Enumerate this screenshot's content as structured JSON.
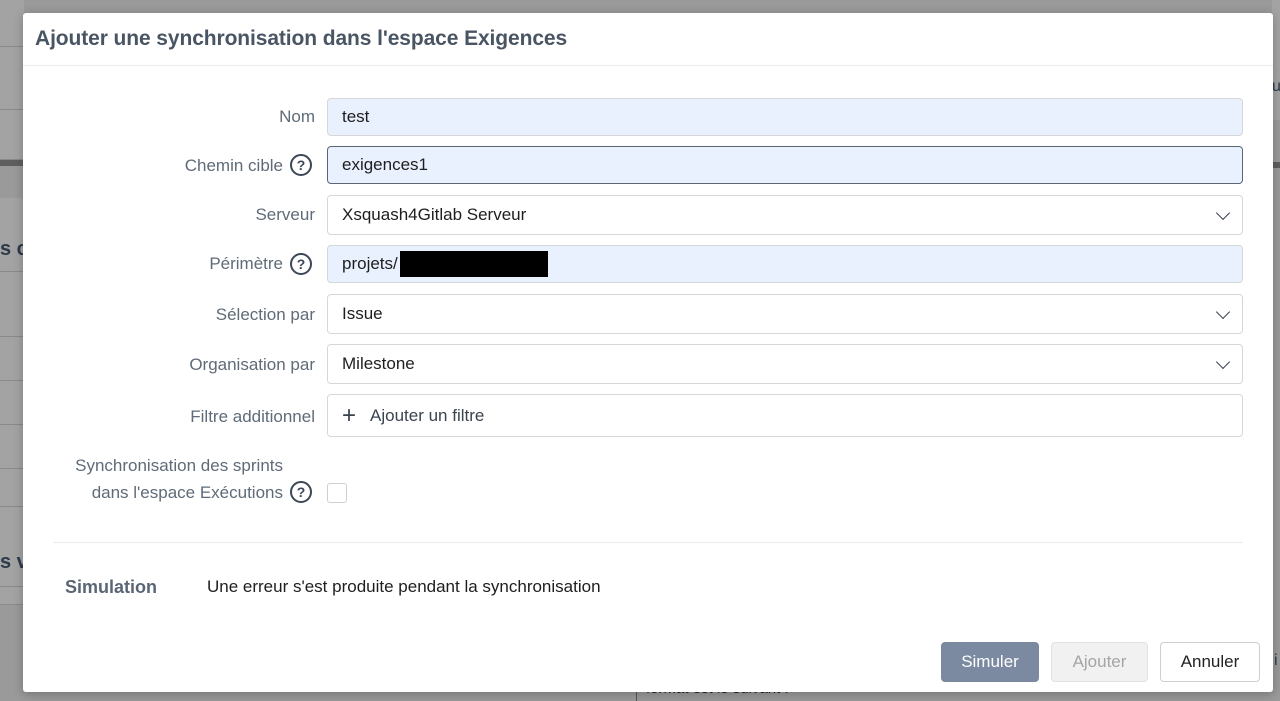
{
  "modal": {
    "title": "Ajouter une synchronisation dans l'espace Exigences"
  },
  "form": {
    "name": {
      "label": "Nom",
      "value": "test"
    },
    "target_path": {
      "label": "Chemin cible",
      "value": "exigences1",
      "help_icon": "question-circle-icon"
    },
    "server": {
      "label": "Serveur",
      "value": "Xsquash4Gitlab Serveur"
    },
    "scope": {
      "label": "Périmètre",
      "value": "projets/",
      "help_icon": "question-circle-icon"
    },
    "selection_by": {
      "label": "Sélection par",
      "value": "Issue"
    },
    "organisation_by": {
      "label": "Organisation par",
      "value": "Milestone"
    },
    "additional_filter": {
      "label": "Filtre additionnel",
      "button_label": "Ajouter un filtre"
    },
    "sprint_sync": {
      "label_line1": "Synchronisation des sprints",
      "label_line2": "dans l'espace Exécutions",
      "checked": false
    }
  },
  "simulation": {
    "label": "Simulation",
    "message": "Une erreur s'est produite pendant la synchronisation"
  },
  "buttons": {
    "simulate": "Simuler",
    "add": "Ajouter",
    "cancel": "Annuler"
  },
  "background": {
    "fragment_s_c": "s c",
    "fragment_s_v": "s v",
    "fragment_right_1": "u",
    "fragment_right_2": "i",
    "bottom_text": "format est le suivant :"
  },
  "colors": {
    "primary_button": "#7b8aa1",
    "filled_input_bg": "#e9f0fe",
    "title_color": "#4a5564"
  }
}
